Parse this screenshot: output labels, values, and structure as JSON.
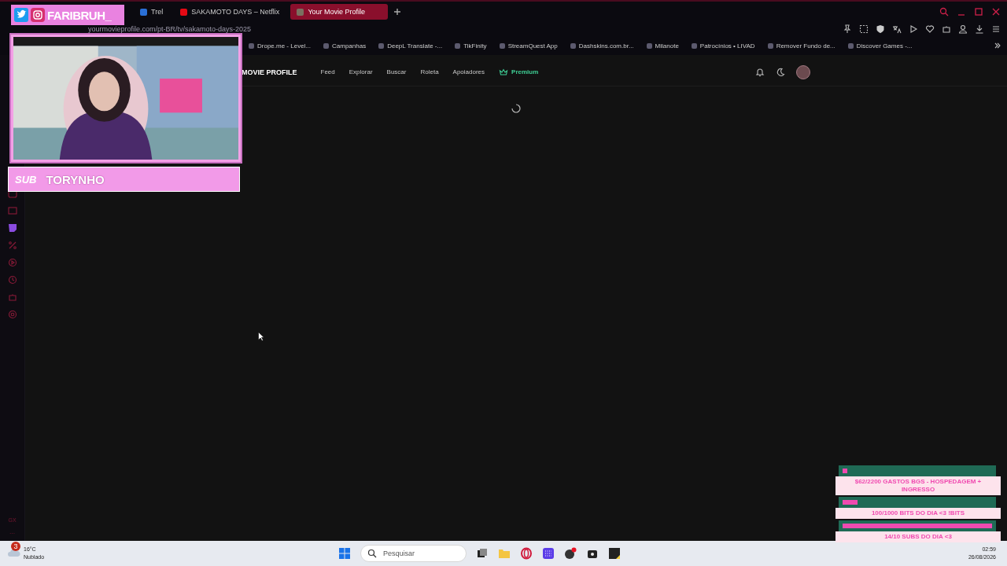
{
  "browser": {
    "tabs": [
      {
        "title": "Trel",
        "kind": "trello",
        "selected": false
      },
      {
        "title": "SAKAMOTO DAYS – Netflix",
        "kind": "netflix",
        "selected": false
      },
      {
        "title": "Your Movie Profile",
        "kind": "site",
        "selected": true
      }
    ],
    "address": "yourmovieprofile.com/pt-BR/tv/sakamoto-days-2025",
    "bookmarks": [
      {
        "title": "Drope.me - Level..."
      },
      {
        "title": "Campanhas"
      },
      {
        "title": "DeepL Translate -..."
      },
      {
        "title": "TikFinity"
      },
      {
        "title": "StreamQuest App"
      },
      {
        "title": "Dashskins.com.br..."
      },
      {
        "title": "Milanote"
      },
      {
        "title": "Patrocínios • LIVAD"
      },
      {
        "title": "Remover Fundo de..."
      },
      {
        "title": "Discover Games -..."
      }
    ],
    "sidebar_footer": [
      "GX",
      "···"
    ]
  },
  "site_nav": {
    "brand": "MOVIE PROFILE",
    "links": [
      {
        "label": "Feed",
        "kind": "plain"
      },
      {
        "label": "Explorar",
        "kind": "plain"
      },
      {
        "label": "Buscar",
        "kind": "plain"
      },
      {
        "label": "Roleta",
        "kind": "plain"
      },
      {
        "label": "Apoiadores",
        "kind": "plain"
      },
      {
        "label": "Premium",
        "kind": "premium"
      }
    ]
  },
  "stream_overlay": {
    "handle": "FARIBRUH_",
    "sub_alert": {
      "label": "SUB",
      "name": "TORYNHO"
    },
    "goals": [
      {
        "text": "$62/2200 GASTOS BGS - HOSPEDAGEM + INGRESSO",
        "level": 0.03
      },
      {
        "text": "100/1000 BITS DO DIA <3 !BITS",
        "level": 0.1
      },
      {
        "text": "14/10 SUBS DO DIA <3",
        "level": 1
      }
    ]
  },
  "taskbar": {
    "weather": {
      "badge": "3",
      "temperature": "16°C",
      "condition": "Nublado"
    },
    "search_placeholder": "Pesquisar",
    "clock": {
      "time": "02:59",
      "date": "26/08/2026"
    }
  }
}
